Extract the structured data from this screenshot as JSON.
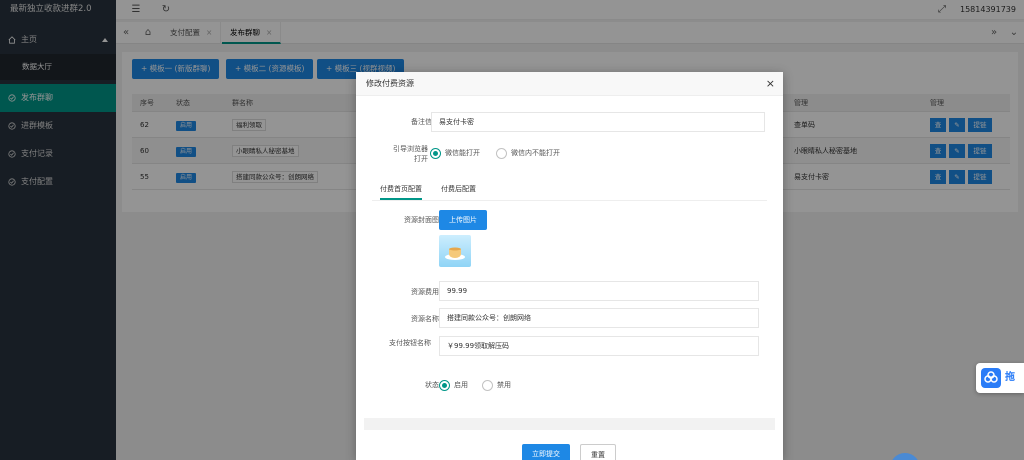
{
  "app": {
    "title": "最新独立收款进群2.0"
  },
  "sidebar": {
    "home": "主页",
    "sub": "数据大厅",
    "items": [
      {
        "label": "发布群聊",
        "active": true
      },
      {
        "label": "进群模板"
      },
      {
        "label": "支付记录"
      },
      {
        "label": "支付配置"
      }
    ]
  },
  "topbar": {
    "user": "15814391739"
  },
  "tabs": [
    {
      "label": "支付配置"
    },
    {
      "label": "发布群聊"
    }
  ],
  "templates": [
    "+ 模板一 (新版群聊)",
    "+ 模板二 (资源模板)",
    "+ 模板三 (视群视频)"
  ],
  "table": {
    "headers": {
      "no": "序号",
      "status": "状态",
      "name": "群名称",
      "manage1": "管理",
      "manage2": "管理"
    },
    "rows": [
      {
        "no": "62",
        "status": "启用",
        "name": "福利领取",
        "manage": "查单码"
      },
      {
        "no": "60",
        "status": "启用",
        "name": "小眼睛私人秘密基地",
        "manage": "小眼睛私人秘密基地"
      },
      {
        "no": "55",
        "status": "启用",
        "name": "搭建同款公众号：创朗网络",
        "manage": "易支付卡密"
      }
    ],
    "actions": {
      "view": "查",
      "edit": "✎",
      "extract": "提链"
    }
  },
  "modal": {
    "title": "修改付费资源",
    "note_label": "备注信息",
    "note_value": "易支付卡密",
    "browser_label": "引导浏览器打开",
    "browser_opt1": "微信能打开",
    "browser_opt2": "微信内不能打开",
    "subtab1": "付费首页配置",
    "subtab2": "付费后配置",
    "cover_label": "资源封面图",
    "upload_label": "上传图片",
    "fee_label": "资源费用",
    "fee_value": "99.99",
    "name_label": "资源名称",
    "name_value": "搭建同款公众号：创朗网络",
    "paybtn_label": "支付按钮名称",
    "paybtn_value": "￥99.99领取解压码",
    "status_label": "状态",
    "status_on": "启用",
    "status_off": "禁用",
    "submit": "立即提交",
    "reset": "重置"
  },
  "widget": {
    "text": "拖"
  }
}
